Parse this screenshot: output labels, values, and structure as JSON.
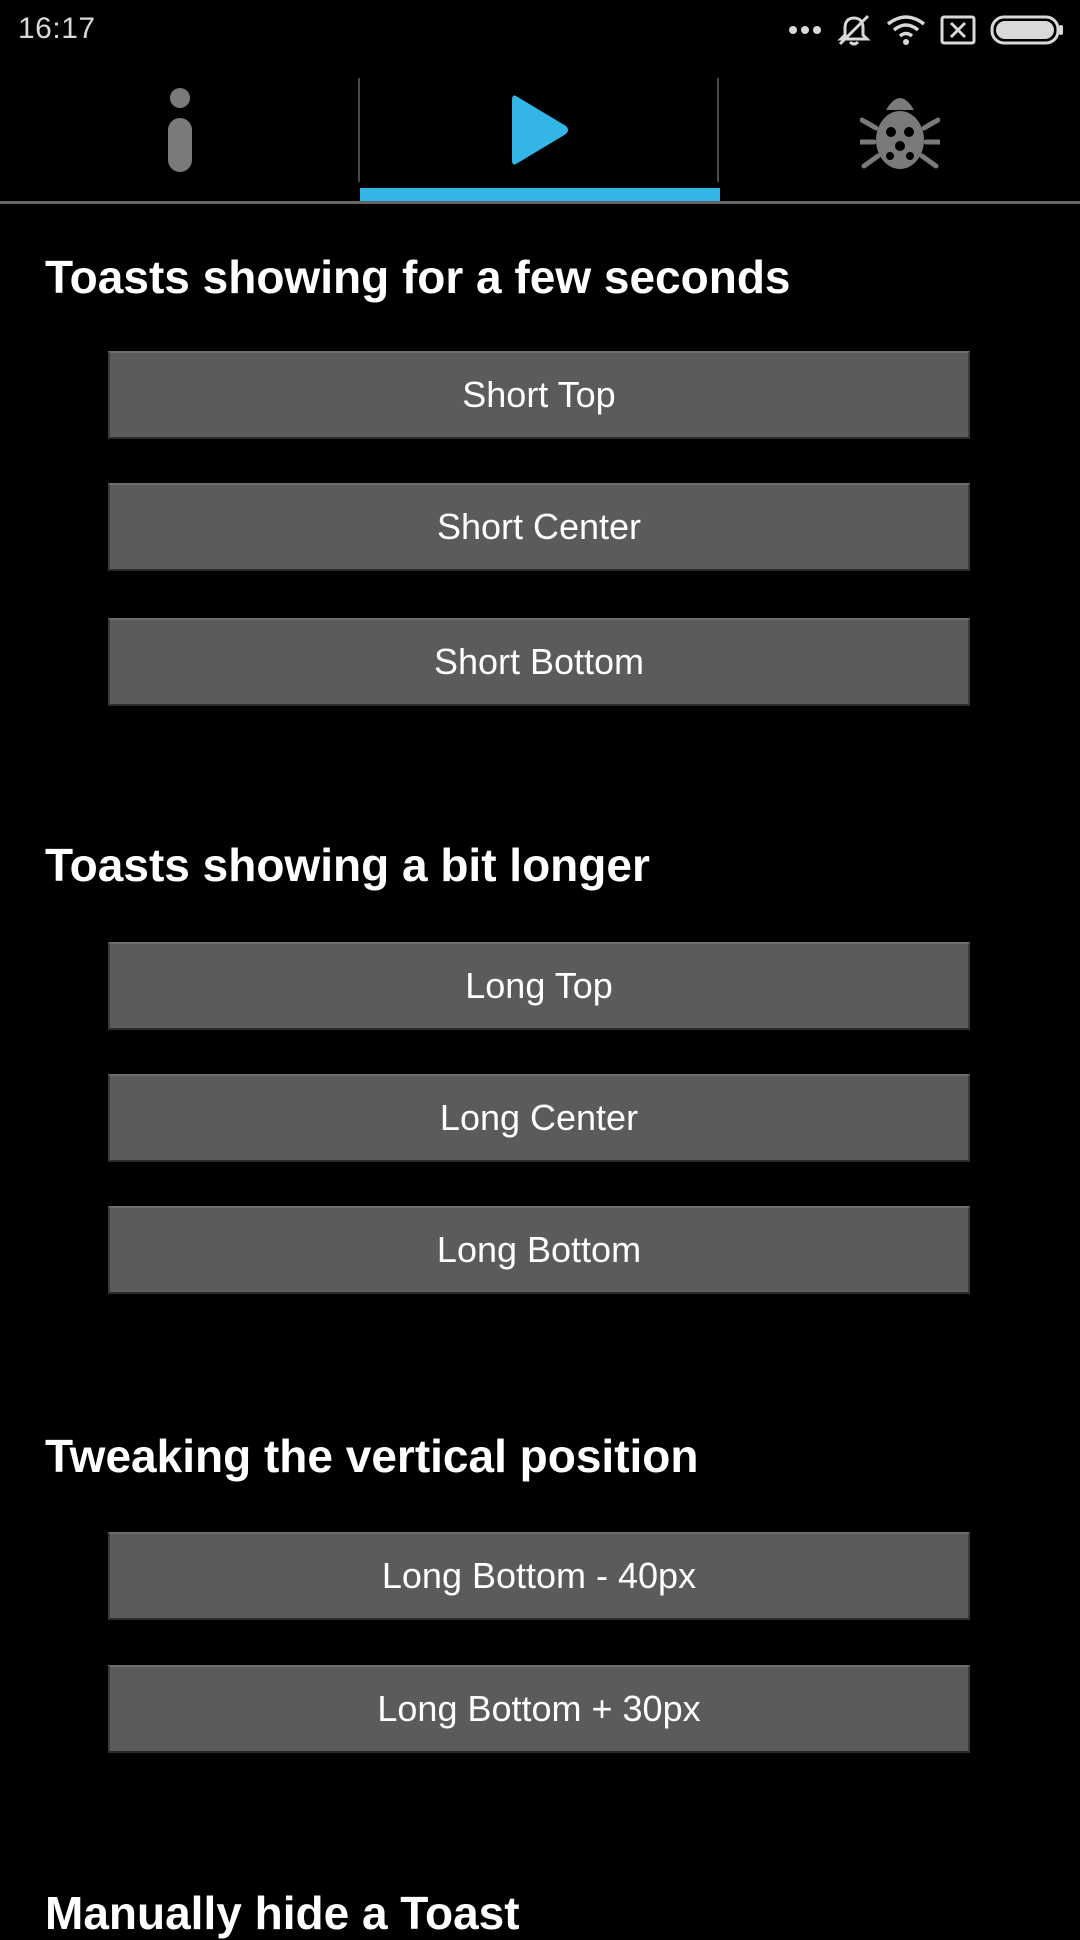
{
  "status_bar": {
    "time": "16:17",
    "icons": [
      "more-dots-icon",
      "vibrate-off-icon",
      "wifi-icon",
      "no-sim-icon",
      "battery-icon"
    ]
  },
  "tabs": [
    {
      "icon": "info-icon",
      "selected": false
    },
    {
      "icon": "play-icon",
      "selected": true
    },
    {
      "icon": "bug-icon",
      "selected": false
    }
  ],
  "colors": {
    "accent": "#33b5e5",
    "background": "#000000",
    "button": "#5b5b5b",
    "icon_gray": "#7a7a7a"
  },
  "sections": [
    {
      "title": "Toasts showing for a few seconds",
      "buttons": [
        "Short Top",
        "Short Center",
        "Short Bottom"
      ]
    },
    {
      "title": "Toasts showing a bit longer",
      "buttons": [
        "Long Top",
        "Long Center",
        "Long Bottom"
      ]
    },
    {
      "title": "Tweaking the vertical position",
      "buttons": [
        "Long Bottom - 40px",
        "Long Bottom + 30px"
      ]
    },
    {
      "title": "Manually hide a Toast",
      "buttons": []
    }
  ]
}
